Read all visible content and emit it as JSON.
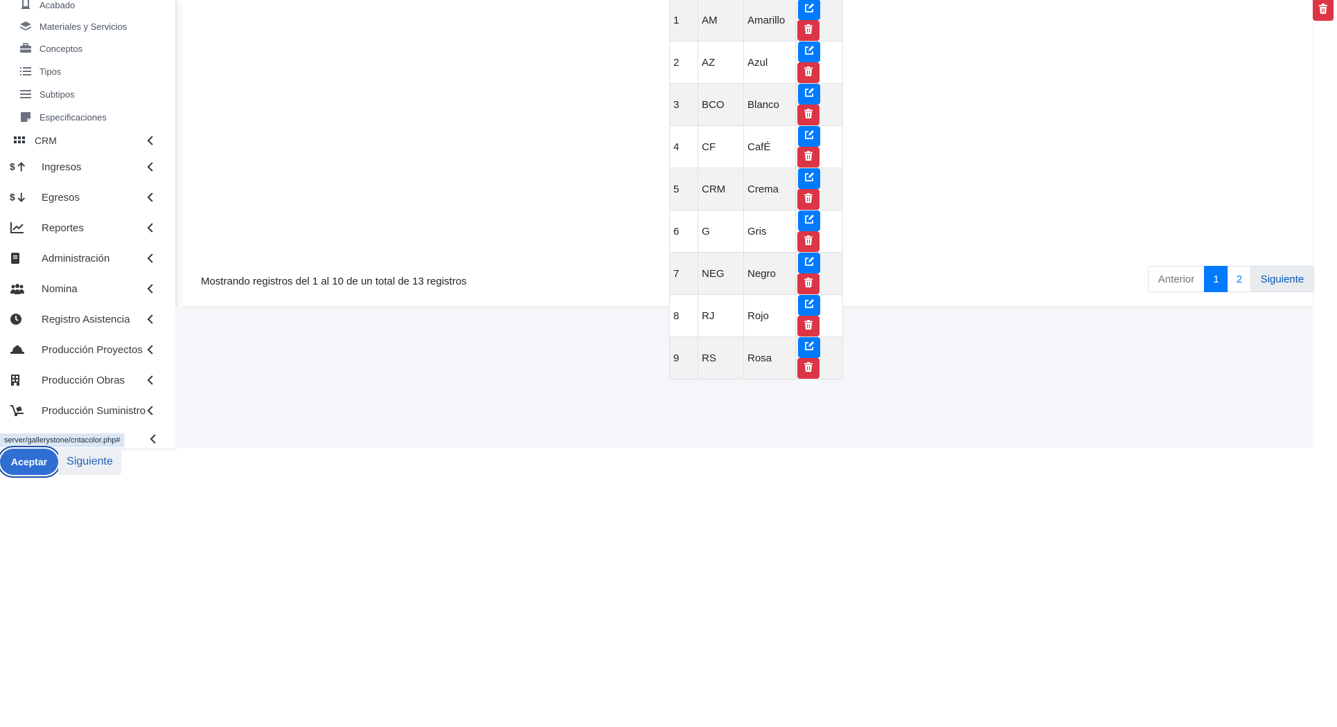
{
  "sidebar": {
    "sub_items": [
      {
        "label": "Acabado",
        "icon": "frame-icon"
      },
      {
        "label": "Materiales y Servicios",
        "icon": "layers-icon"
      },
      {
        "label": "Conceptos",
        "icon": "toolbox-icon"
      },
      {
        "label": "Tipos",
        "icon": "list-icon"
      },
      {
        "label": "Subtipos",
        "icon": "menu-lines-icon"
      },
      {
        "label": "Especificaciones",
        "icon": "sticky-note-icon"
      }
    ],
    "crm_label": "CRM",
    "nav_items": [
      {
        "label": "Ingresos",
        "icon": "dollar-up-icon"
      },
      {
        "label": "Egresos",
        "icon": "dollar-down-icon"
      },
      {
        "label": "Reportes",
        "icon": "chart-line-icon"
      },
      {
        "label": "Administración",
        "icon": "book-icon"
      },
      {
        "label": "Nomina",
        "icon": "users-icon"
      },
      {
        "label": "Registro Asistencia",
        "icon": "clock-icon"
      },
      {
        "label": "Producción Proyectos",
        "icon": "hard-hat-icon"
      },
      {
        "label": "Producción Obras",
        "icon": "building-icon"
      },
      {
        "label": "Producción Suministro",
        "icon": "dolly-icon"
      }
    ],
    "status_url": "server/gallerystone/cntacolor.php#"
  },
  "table": {
    "rows": [
      {
        "num": "1",
        "code": "AM",
        "name": "Amarillo"
      },
      {
        "num": "2",
        "code": "AZ",
        "name": "Azul"
      },
      {
        "num": "3",
        "code": "BCO",
        "name": "Blanco"
      },
      {
        "num": "4",
        "code": "CF",
        "name": "CafÉ"
      },
      {
        "num": "5",
        "code": "CRM",
        "name": "Crema"
      },
      {
        "num": "6",
        "code": "G",
        "name": "Gris"
      },
      {
        "num": "7",
        "code": "NEG",
        "name": "Negro"
      },
      {
        "num": "8",
        "code": "RJ",
        "name": "Rojo"
      },
      {
        "num": "9",
        "code": "RS",
        "name": "Rosa"
      }
    ]
  },
  "info": "Mostrando registros del 1 al 10 de un total de 13 registros",
  "pagination": {
    "prev": "Anterior",
    "page1": "1",
    "page2": "2",
    "next": "Siguiente"
  },
  "tour": {
    "accept": "Aceptar",
    "next": "Siguiente"
  },
  "colors": {
    "primary": "#007bff",
    "danger": "#dc3545",
    "content_bg": "#f4f6f9"
  }
}
